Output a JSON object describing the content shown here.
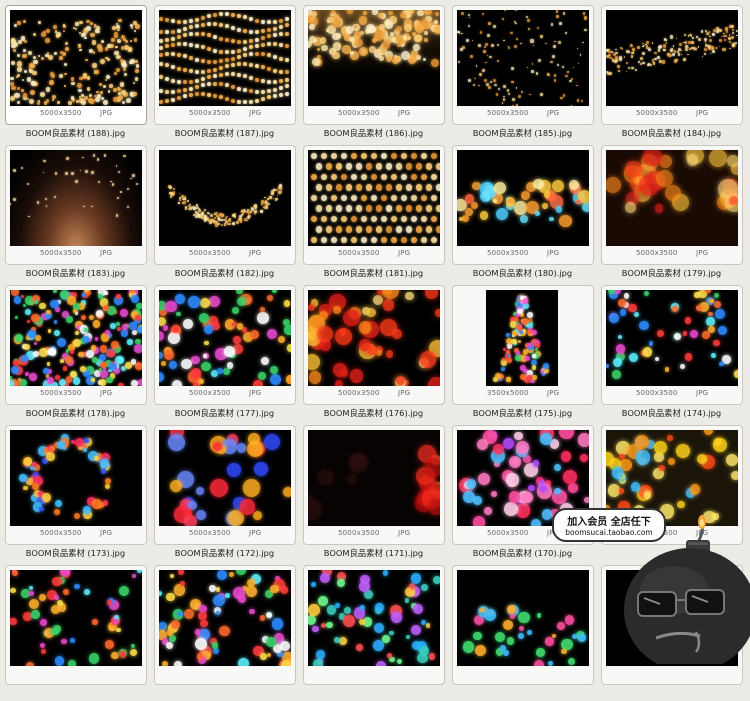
{
  "files": [
    {
      "name": "BOOM良品素材 (188).jpg",
      "dims": "5000x3500",
      "format": "JPG",
      "selected": true,
      "orientation": "landscape",
      "style": "string-lights-warm"
    },
    {
      "name": "BOOM良品素材 (187).jpg",
      "dims": "5000x3500",
      "format": "JPG",
      "selected": false,
      "orientation": "landscape",
      "style": "wave-lights"
    },
    {
      "name": "BOOM良品素材 (186).jpg",
      "dims": "5000x3500",
      "format": "JPG",
      "selected": false,
      "orientation": "landscape",
      "style": "top-glow"
    },
    {
      "name": "BOOM良品素材 (185).jpg",
      "dims": "5000x3500",
      "format": "JPG",
      "selected": false,
      "orientation": "landscape",
      "style": "sparse-sparkle"
    },
    {
      "name": "BOOM良品素材 (184).jpg",
      "dims": "5000x3500",
      "format": "JPG",
      "selected": false,
      "orientation": "landscape",
      "style": "glitter-band"
    },
    {
      "name": "BOOM良品素材 (183).jpg",
      "dims": "5000x3500",
      "format": "JPG",
      "selected": false,
      "orientation": "landscape",
      "style": "light-burst"
    },
    {
      "name": "BOOM良品素材 (182).jpg",
      "dims": "5000x3500",
      "format": "JPG",
      "selected": false,
      "orientation": "landscape",
      "style": "glitter-curve"
    },
    {
      "name": "BOOM良品素材 (181).jpg",
      "dims": "5000x3500",
      "format": "JPG",
      "selected": false,
      "orientation": "landscape",
      "style": "gold-bokeh-dense"
    },
    {
      "name": "BOOM良品素材 (180).jpg",
      "dims": "5000x3500",
      "format": "JPG",
      "selected": false,
      "orientation": "landscape",
      "style": "color-bokeh-band"
    },
    {
      "name": "BOOM良品素材 (179).jpg",
      "dims": "5000x3500",
      "format": "JPG",
      "selected": false,
      "orientation": "landscape",
      "style": "warm-bokeh-large"
    },
    {
      "name": "BOOM良品素材 (178).jpg",
      "dims": "5000x3500",
      "format": "JPG",
      "selected": false,
      "orientation": "landscape",
      "style": "multicolor-dense"
    },
    {
      "name": "BOOM良品素材 (177).jpg",
      "dims": "5000x3500",
      "format": "JPG",
      "selected": false,
      "orientation": "landscape",
      "style": "multicolor-medium"
    },
    {
      "name": "BOOM良品素材 (176).jpg",
      "dims": "5000x3500",
      "format": "JPG",
      "selected": false,
      "orientation": "landscape",
      "style": "warm-bokeh-red"
    },
    {
      "name": "BOOM良品素材 (175).jpg",
      "dims": "3500x5000",
      "format": "JPG",
      "selected": false,
      "orientation": "portrait",
      "style": "tree"
    },
    {
      "name": "BOOM良品素材 (174).jpg",
      "dims": "5000x3500",
      "format": "JPG",
      "selected": false,
      "orientation": "landscape",
      "style": "multicolor-sparse"
    },
    {
      "name": "BOOM良品素材 (173).jpg",
      "dims": "5000x3500",
      "format": "JPG",
      "selected": false,
      "orientation": "landscape",
      "style": "ring-bokeh"
    },
    {
      "name": "BOOM良品素材 (172).jpg",
      "dims": "5000x3500",
      "format": "JPG",
      "selected": false,
      "orientation": "landscape",
      "style": "blue-red-large"
    },
    {
      "name": "BOOM良品素材 (171).jpg",
      "dims": "5000x3500",
      "format": "JPG",
      "selected": false,
      "orientation": "landscape",
      "style": "dark-red-edge"
    },
    {
      "name": "BOOM良品素材 (170).jpg",
      "dims": "5000x3500",
      "format": "JPG",
      "selected": false,
      "orientation": "landscape",
      "style": "pink-bokeh"
    },
    {
      "name": "",
      "dims": "5000x3500",
      "format": "JPG",
      "selected": false,
      "orientation": "landscape",
      "style": "yellow-bokeh"
    },
    {
      "name": "",
      "dims": "",
      "format": "",
      "selected": false,
      "orientation": "landscape",
      "style": "multicolor-sparse"
    },
    {
      "name": "",
      "dims": "",
      "format": "",
      "selected": false,
      "orientation": "landscape",
      "style": "multicolor-medium"
    },
    {
      "name": "",
      "dims": "",
      "format": "",
      "selected": false,
      "orientation": "landscape",
      "style": "teal-bokeh"
    },
    {
      "name": "",
      "dims": "",
      "format": "",
      "selected": false,
      "orientation": "landscape",
      "style": "green-pink"
    },
    {
      "name": "",
      "dims": "",
      "format": "",
      "selected": false,
      "orientation": "landscape",
      "style": "dark-empty"
    }
  ],
  "promo": {
    "headline": "加入会员 全店任下",
    "url": "boomsucai.taobao.com"
  },
  "colors": {
    "background": "#ecebe6",
    "card": "#f8f8f6",
    "card_border": "#c8c6bf",
    "mascot_body": "#2b2b2b",
    "fuse_flame": "#f4a23a"
  }
}
